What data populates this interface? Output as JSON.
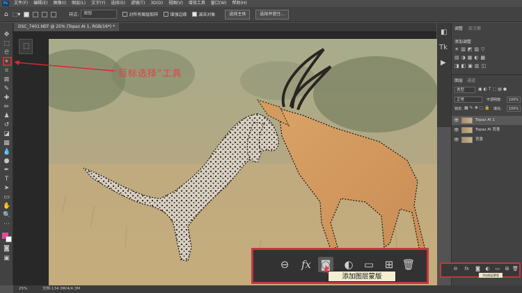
{
  "menu": {
    "logo": "Ps",
    "items": [
      "文件(F)",
      "编辑(E)",
      "图像(I)",
      "图层(L)",
      "文字(Y)",
      "选择(S)",
      "滤镜(T)",
      "3D(D)",
      "视图(V)",
      "增效工具",
      "窗口(W)",
      "帮助(H)"
    ]
  },
  "options": {
    "style_label": "样式:",
    "style_value": "矩形",
    "sample_all_label": "对所有图层取样",
    "enhance_edge_label": "增强边缘",
    "subtract_label": "减去对象",
    "select_subject_button": "选择主体",
    "select_and_mask_button": "选择并遮住..."
  },
  "document": {
    "tab_title": "DSC_7401.NEF @ 25% (Topaz AI 1, RGB/16*) *",
    "zoom": "25%",
    "file_info": "文档:134.3M/4/4.3M"
  },
  "annotation": {
    "text": "“目标选择”工具",
    "color": "#e24149"
  },
  "adjustments_panel": {
    "tabs": [
      "调整",
      "库方面"
    ],
    "title": "添加调整"
  },
  "layers_panel": {
    "tabs": [
      "图层",
      "通道"
    ],
    "filter_label": "类型",
    "blend_mode": "正常",
    "opacity_label": "不透明度:",
    "opacity_value": "100%",
    "lock_label": "锁定:",
    "fill_label": "填充:",
    "fill_value": "100%",
    "layers": [
      {
        "name": "Topaz AI 1"
      },
      {
        "name": "Topaz AI 背景"
      },
      {
        "name": "背景"
      }
    ]
  },
  "layer_footer": {
    "icons": [
      "link-icon",
      "fx-icon",
      "mask-icon",
      "adjustment-icon",
      "folder-icon",
      "new-layer-icon",
      "trash-icon"
    ],
    "fx_label": "fx",
    "tooltip": "添加图层蒙版",
    "small_tooltip": "添加图层蒙版"
  },
  "colors": {
    "highlight": "#c4373e",
    "foreground_swatch": "#e34aa0",
    "background_swatch": "#ffffff"
  }
}
